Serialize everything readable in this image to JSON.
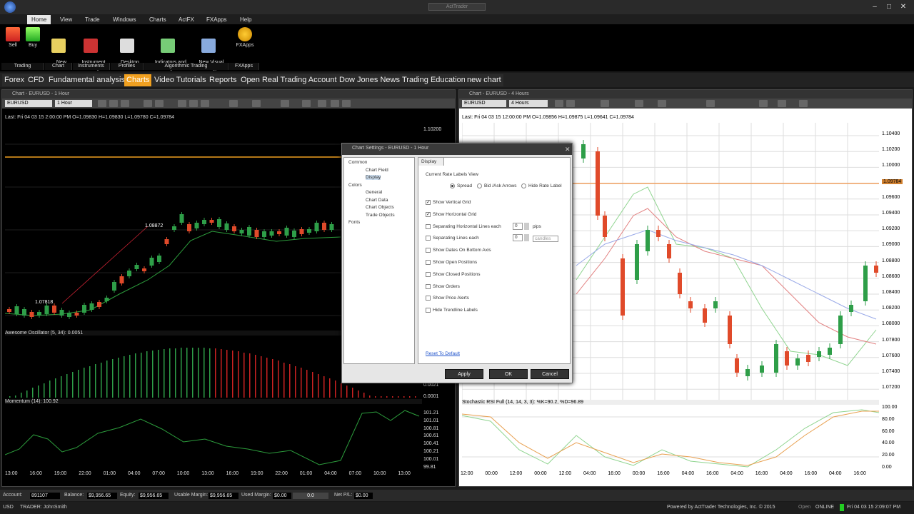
{
  "app": {
    "title": "ActTrader",
    "colors": {
      "accent": "#f0a020",
      "buy": "#2e9e48",
      "sell": "#e04a2a"
    }
  },
  "menu": [
    {
      "label": "Home",
      "active": true
    },
    {
      "label": "View"
    },
    {
      "label": "Trade"
    },
    {
      "label": "Windows"
    },
    {
      "label": "Charts"
    },
    {
      "label": "ActFX"
    },
    {
      "label": "FXApps"
    },
    {
      "label": "Help"
    }
  ],
  "ribbon": {
    "buttons": [
      {
        "label": "Sell",
        "icon": "arrow-down-icon"
      },
      {
        "label": "Buy",
        "icon": "arrow-up-icon"
      },
      {
        "label": "New\nChart",
        "icon": "new-chart-icon"
      },
      {
        "label": "Instrument\nCatalog",
        "icon": "instrument-catalog-icon"
      },
      {
        "label": "Desktop\nProfile",
        "icon": "desktop-profile-icon"
      },
      {
        "label": "Indicators and\nStrategies",
        "icon": "indicators-icon"
      },
      {
        "label": "New Visual\nStrategy",
        "icon": "visual-strategy-icon"
      },
      {
        "label": "FXApps",
        "icon": "fxapps-icon"
      }
    ],
    "groups": [
      "Trading",
      "Chart",
      "Instruments",
      "Profiles",
      "Algorithmic Trading",
      "FXApps"
    ]
  },
  "tabs": [
    {
      "label": "Forex"
    },
    {
      "label": "CFD"
    },
    {
      "label": "Fundamental analysis"
    },
    {
      "label": "Charts",
      "active": true
    },
    {
      "label": "Video Tutorials"
    },
    {
      "label": "Reports"
    },
    {
      "label": "Open Real Trading Account"
    },
    {
      "label": "Dow Jones News"
    },
    {
      "label": "Trading Education"
    },
    {
      "label": "new chart"
    }
  ],
  "left_chart": {
    "title": "Chart - EURUSD - 1 Hour",
    "symbol": "EURUSD",
    "timeframe": "1 Hour",
    "ohlc": "Last: Fri 04 03 15 2:00:00 PM O=1.09830 H=1.09830 L=1.09780 C=1.09784",
    "annotation_high": "1.08872",
    "annotation_low": "1.07818",
    "price_top": "1.10200",
    "osc_title": "Awesome Oscillator (5, 34): 0.0051",
    "osc_value": "0.0021",
    "osc_low": "0.0001",
    "mom_title": "Momentum (14): 100.92",
    "mom_axis": [
      "101.21",
      "101.01",
      "100.81",
      "100.61",
      "100.41",
      "100.21",
      "100.01",
      "99.81"
    ],
    "time_axis": [
      "13:00",
      "16:00",
      "19:00",
      "22:00",
      "01:00",
      "04:00",
      "07:00",
      "10:00",
      "13:00",
      "16:00",
      "19:00",
      "22:00",
      "01:00",
      "04:00",
      "07:00",
      "10:00",
      "13:00"
    ]
  },
  "right_chart": {
    "title": "Chart - EURUSD - 4 Hours",
    "symbol": "EURUSD",
    "timeframe": "4 Hours",
    "ohlc": "Last: Fri 04 03 15 12:00:00 PM O=1.09856 H=1.09875 L=1.09641 C=1.09784",
    "price_axis": [
      "1.10400",
      "1.10200",
      "1.10000",
      "1.09784",
      "1.09600",
      "1.09400",
      "1.09200",
      "1.09000",
      "1.08800",
      "1.08600",
      "1.08400",
      "1.08200",
      "1.08000",
      "1.07800",
      "1.07600",
      "1.07400",
      "1.07200"
    ],
    "stoch_title": "Stochastic RSI Full (14, 14, 3, 3): %K=90.2, %D=96.89",
    "stoch_axis": [
      "100.00",
      "80.00",
      "60.00",
      "40.00",
      "20.00",
      "0.00"
    ],
    "time_axis": [
      "12:00",
      "00:00",
      "12:00",
      "00:00",
      "12:00",
      "04:00",
      "16:00",
      "00:00",
      "16:00",
      "04:00",
      "16:00",
      "04:00",
      "16:00",
      "04:00",
      "16:00",
      "04:00",
      "16:00"
    ]
  },
  "dialog": {
    "title": "Chart Settings - EURUSD - 1 Hour",
    "tree": [
      {
        "label": "Common",
        "level": 0,
        "expander": "▲"
      },
      {
        "label": "Chart Field",
        "level": 1
      },
      {
        "label": "Display",
        "level": 1,
        "selected": true
      },
      {
        "label": "Colors",
        "level": 0,
        "expander": "▲"
      },
      {
        "label": "General",
        "level": 1
      },
      {
        "label": "Chart Data",
        "level": 1
      },
      {
        "label": "Chart Objects",
        "level": 1
      },
      {
        "label": "Trade Objects",
        "level": 1
      },
      {
        "label": "Fonts",
        "level": 0
      }
    ],
    "tab": "Display",
    "rate_labels_title": "Current Rate Labels View",
    "radios": [
      {
        "label": "Spread",
        "checked": true
      },
      {
        "label": "Bid /Ask Arrows"
      },
      {
        "label": "Hide Rate Label"
      }
    ],
    "checks": [
      {
        "label": "Show Vertical Grid",
        "checked": true
      },
      {
        "label": "Show Horizontal Grid",
        "checked": true
      },
      {
        "label": "Separating Horizontal Lines each",
        "value": "0",
        "unit": "pips"
      },
      {
        "label": "Separating Lines each",
        "value": "0",
        "unit": "candles"
      },
      {
        "label": "Show Dates On Bottom Axis"
      },
      {
        "label": "Show Open Positions"
      },
      {
        "label": "Show Closed Positions"
      },
      {
        "label": "Show Orders"
      },
      {
        "label": "Show Price Alerts"
      },
      {
        "label": "Hide Trendline Labels"
      }
    ],
    "reset": "Reset To Default",
    "buttons": {
      "apply": "Apply",
      "ok": "OK",
      "cancel": "Cancel"
    }
  },
  "status": {
    "account_label": "Account:",
    "account": "891107",
    "balance_label": "Balance:",
    "balance": "$9,956.65",
    "equity_label": "Equity:",
    "equity": "$9,956.65",
    "usable_label": "Usable Margin:",
    "usable": "$9,956.65",
    "used_label": "Used Margin:",
    "used": "$0.00",
    "pl_value": "0.0",
    "netpl_label": "Net P/L:",
    "netpl": "$0.00"
  },
  "bottom": {
    "currency": "USD",
    "user": "TRADER: JohnSmith",
    "powered": "Powered by ActTrader Technologies, Inc. © 2015",
    "state": "Open",
    "online": "ONLINE",
    "clock": "Fri 04 03 15 2:09:07 PM"
  }
}
